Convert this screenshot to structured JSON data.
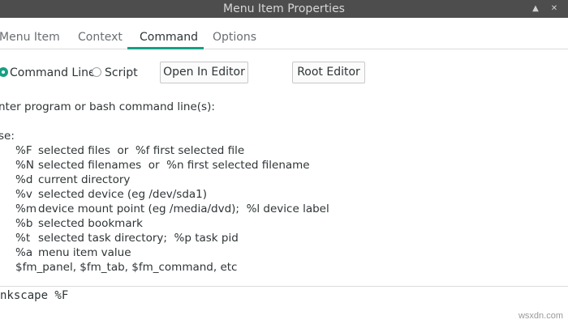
{
  "window": {
    "title": "Menu Item Properties",
    "buttons": [
      {
        "name": "maximize-button",
        "glyph": "▲"
      },
      {
        "name": "close-button",
        "glyph": "✕"
      }
    ]
  },
  "tabs": [
    {
      "label": "Menu Item",
      "active": false
    },
    {
      "label": "Context",
      "active": false
    },
    {
      "label": "Command",
      "active": true
    },
    {
      "label": "Options",
      "active": false
    }
  ],
  "accent_color": "#16a085",
  "command": {
    "type_options": [
      {
        "label": "Command Line",
        "selected": true
      },
      {
        "label": "Script",
        "selected": false
      }
    ],
    "open_in_editor_label": "Open In Editor",
    "root_editor_label": "Root Editor",
    "prompt": "nter program or bash command line(s):",
    "use_heading": "Jse:",
    "help_lines": [
      {
        "code": "%F",
        "text": "selected files  or  %f first selected file"
      },
      {
        "code": "%N",
        "text": "selected filenames  or  %n first selected filename"
      },
      {
        "code": "%d",
        "text": "current directory"
      },
      {
        "code": "%v",
        "text": "selected device (eg /dev/sda1)"
      },
      {
        "code": "%m",
        "text": "device mount point (eg /media/dvd);  %l device label"
      },
      {
        "code": "%b",
        "text": "selected bookmark"
      },
      {
        "code": "%t",
        "text": "selected task directory;  %p task pid"
      },
      {
        "code": "%a",
        "text": "menu item value"
      },
      {
        "code": "",
        "text": "$fm_panel, $fm_tab, $fm_command, etc"
      }
    ],
    "command_value": "nkscape %F"
  },
  "watermark": "wsxdn.com"
}
